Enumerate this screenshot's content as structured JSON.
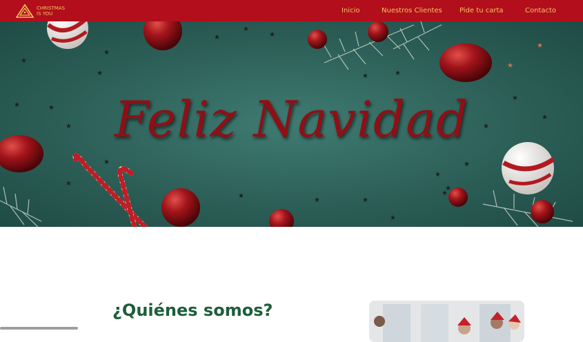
{
  "brand": {
    "line1": "CHRISTMAS",
    "line2": "IS YOU",
    "logo_icon": "tree-triangle-icon"
  },
  "nav": {
    "items": [
      "Inicio",
      "Nuestros Clientes",
      "Pide tu carta",
      "Contacto"
    ]
  },
  "hero": {
    "title": "Feliz Navidad"
  },
  "about": {
    "title": "¿Quiénes somos?"
  },
  "colors": {
    "navbar": "#b20e1c",
    "nav_text": "#f2c75c",
    "hero_bg": "#2c5f57",
    "title_red": "#8e1016",
    "heading_green": "#1e5d3a"
  }
}
